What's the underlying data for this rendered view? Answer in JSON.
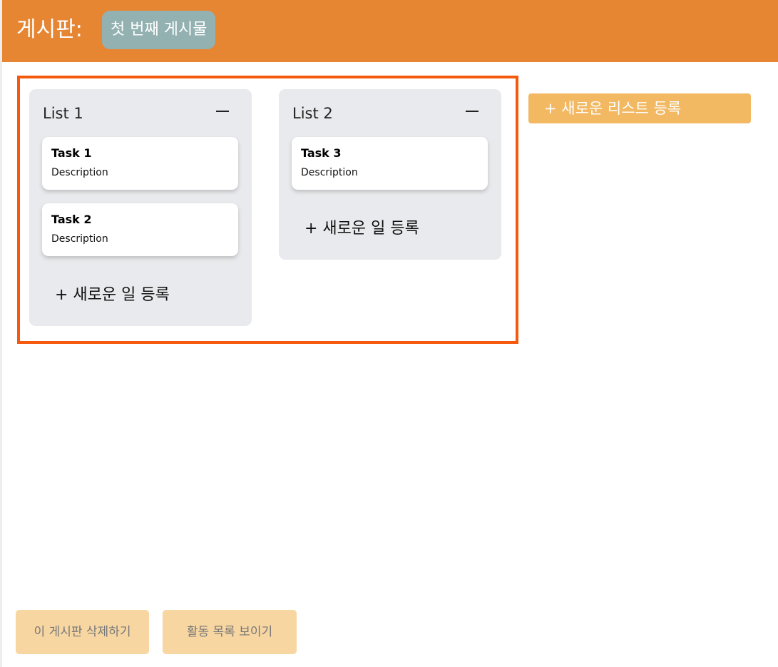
{
  "header": {
    "label": "게시판:",
    "board_title": "첫 번째 게시물"
  },
  "lists": [
    {
      "title": "List 1",
      "cards": [
        {
          "title": "Task 1",
          "description": "Description"
        },
        {
          "title": "Task 2",
          "description": "Description"
        }
      ],
      "add_task_label": "+ 새로운 일 등록"
    },
    {
      "title": "List 2",
      "cards": [
        {
          "title": "Task 3",
          "description": "Description"
        }
      ],
      "add_task_label": "+ 새로운 일 등록"
    }
  ],
  "add_list_label": "+ 새로운 리스트 등록",
  "footer": {
    "delete_board_label": "이 게시판 삭제하기",
    "show_activity_label": "활동 목록 보이기"
  },
  "colors": {
    "header_bg": "#e68532",
    "title_chip_bg": "#93b1b1",
    "frame_border": "#f5590e",
    "list_bg": "#e9eaed",
    "add_list_bg": "#f2b862",
    "footer_btn_bg": "#f7d6a2"
  }
}
